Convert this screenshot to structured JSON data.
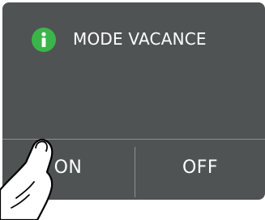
{
  "dialog": {
    "title": "MODE VACANCE",
    "icon": "info-icon",
    "icon_color": "#3bb54a"
  },
  "buttons": {
    "on_label": "ON",
    "off_label": "OFF"
  },
  "colors": {
    "panel": "#4f5353",
    "divider": "#8e9191",
    "text": "#ffffff"
  },
  "overlay": {
    "icon": "pointing-hand-icon"
  }
}
